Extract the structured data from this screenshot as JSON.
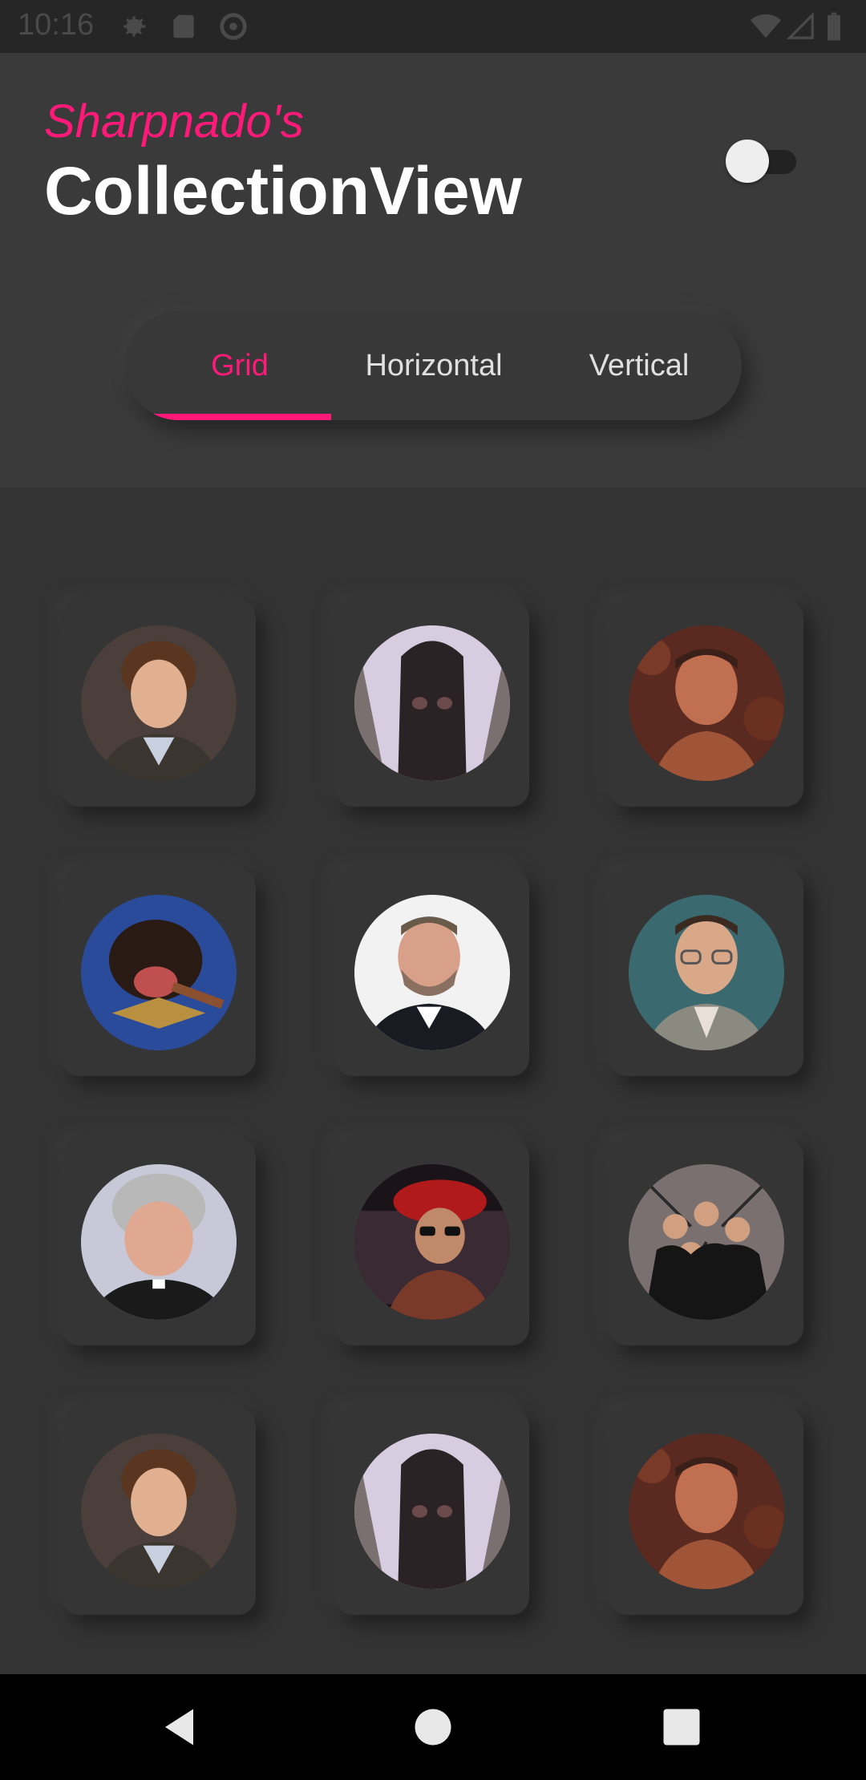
{
  "status_bar": {
    "time": "10:16",
    "icons": [
      "settings-icon",
      "sd-card-icon",
      "sync-icon",
      "wifi-icon",
      "signal-icon",
      "battery-icon"
    ]
  },
  "header": {
    "subtitle": "Sharpnado's",
    "title": "CollectionView",
    "theme_toggle": {
      "state": "off"
    }
  },
  "tabs": [
    {
      "label": "Grid",
      "active": true
    },
    {
      "label": "Horizontal",
      "active": false
    },
    {
      "label": "Vertical",
      "active": false
    }
  ],
  "colors": {
    "accent": "#ff1a7a",
    "background": "#333333",
    "header_background": "#3a3a3a"
  },
  "grid_items": [
    {
      "name": "man-curly-hair-suit-portrait"
    },
    {
      "name": "tree-creature-portrait"
    },
    {
      "name": "action-hero-portrait"
    },
    {
      "name": "puppet-dog-cigar-portrait"
    },
    {
      "name": "bearded-man-suit-portrait"
    },
    {
      "name": "man-glasses-suit-portrait"
    },
    {
      "name": "grey-haired-priest-portrait"
    },
    {
      "name": "man-red-hat-glasses-portrait"
    },
    {
      "name": "group-men-suits-portrait"
    },
    {
      "name": "man-curly-hair-suit-portrait"
    },
    {
      "name": "tree-creature-portrait"
    },
    {
      "name": "action-hero-portrait"
    }
  ],
  "nav_bar": {
    "buttons": [
      "back-icon",
      "home-icon",
      "recents-icon"
    ]
  }
}
